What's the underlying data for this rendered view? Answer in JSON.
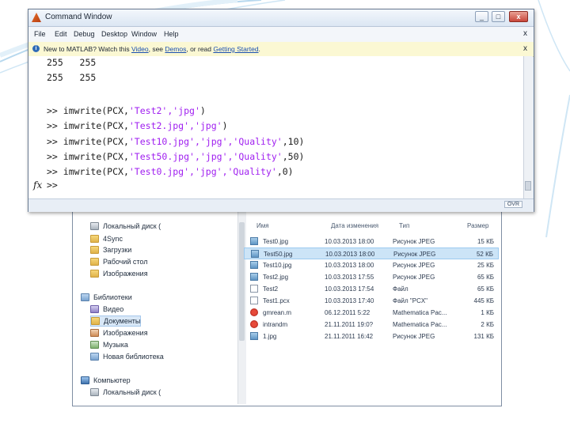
{
  "command_window": {
    "title": "Command Window",
    "window_controls": {
      "minimize": "_",
      "maximize": "□",
      "close": "x"
    },
    "menu": [
      "File",
      "Edit",
      "Debug",
      "Desktop",
      "Window",
      "Help"
    ],
    "menu_close": "x",
    "info": {
      "prefix": "New to MATLAB? Watch this ",
      "video": "Video",
      "mid1": ", see ",
      "demos": "Demos",
      "mid2": ", or read ",
      "getting_started": "Getting Started",
      "suffix": ".",
      "close": "x"
    },
    "output_lines": [
      "255   255",
      "255   255"
    ],
    "commands": [
      {
        "prompt": ">> ",
        "before": "imwrite(PCX,",
        "str": "'Test2','jpg'",
        "after": ")"
      },
      {
        "prompt": ">> ",
        "before": "imwrite(PCX,",
        "str": "'Test2.jpg','jpg'",
        "after": ")"
      },
      {
        "prompt": ">> ",
        "before": "imwrite(PCX,",
        "str": "'Test10.jpg','jpg','Quality'",
        "after": ",10)"
      },
      {
        "prompt": ">> ",
        "before": "imwrite(PCX,",
        "str": "'Test50.jpg','jpg','Quality'",
        "after": ",50)"
      },
      {
        "prompt": ">> ",
        "before": "imwrite(PCX,",
        "str": "'Test0.jpg','jpg','Quality'",
        "after": ",0)"
      }
    ],
    "fx": "fx",
    "current_prompt": ">>",
    "status_ovr": "OVR"
  },
  "explorer": {
    "nav_items": [
      {
        "label": "Локальный диск (",
        "icon": "drive"
      },
      {
        "label": "4Sync",
        "icon": "folder"
      },
      {
        "label": "Загрузки",
        "icon": "folder"
      },
      {
        "label": "Рабочий стол",
        "icon": "folder"
      },
      {
        "label": "Изображения",
        "icon": "folder"
      },
      {
        "label": "Библиотеки",
        "icon": "library"
      },
      {
        "label": "Видео",
        "icon": "video"
      },
      {
        "label": "Документы",
        "icon": "folder"
      },
      {
        "label": "Изображения",
        "icon": "pics"
      },
      {
        "label": "Музыка",
        "icon": "music"
      },
      {
        "label": "Новая библиотека",
        "icon": "library"
      },
      {
        "label": "Компьютер",
        "icon": "computer"
      },
      {
        "label": "Локальный диск (",
        "icon": "drive"
      }
    ],
    "columns": {
      "name": "Имя",
      "date": "Дата изменения",
      "type": "Тип",
      "size": "Размер"
    },
    "files": [
      {
        "name": "Test0.jpg",
        "date": "10.03.2013 18:00",
        "type": "Рисунок JPEG",
        "size": "15 КБ",
        "icon": "jpg"
      },
      {
        "name": "Test50.jpg",
        "date": "10.03.2013 18:00",
        "type": "Рисунок JPEG",
        "size": "52 КБ",
        "icon": "jpg"
      },
      {
        "name": "Test10.jpg",
        "date": "10.03.2013 18:00",
        "type": "Рисунок JPEG",
        "size": "25 КБ",
        "icon": "jpg"
      },
      {
        "name": "Test2.jpg",
        "date": "10.03.2013 17:55",
        "type": "Рисунок JPEG",
        "size": "65 КБ",
        "icon": "jpg"
      },
      {
        "name": "Test2",
        "date": "10.03.2013 17:54",
        "type": "Файл",
        "size": "65 КБ",
        "icon": "pcx"
      },
      {
        "name": "Test1.pcx",
        "date": "10.03.2013 17:40",
        "type": "Файл \"PCX\"",
        "size": "445 КБ",
        "icon": "pcx"
      },
      {
        "name": "gmrean.m",
        "date": "06.12.2011 5:22",
        "type": "Mathematica Pac...",
        "size": "1 КБ",
        "icon": "mma"
      },
      {
        "name": "intrandm",
        "date": "21.11.2011 19:0?",
        "type": "Mathematica Pac...",
        "size": "2 КБ",
        "icon": "mma"
      },
      {
        "name": "1.jpg",
        "date": "21.11.2011 16:42",
        "type": "Рисунок JPEG",
        "size": "131 КБ",
        "icon": "jpg"
      }
    ]
  }
}
